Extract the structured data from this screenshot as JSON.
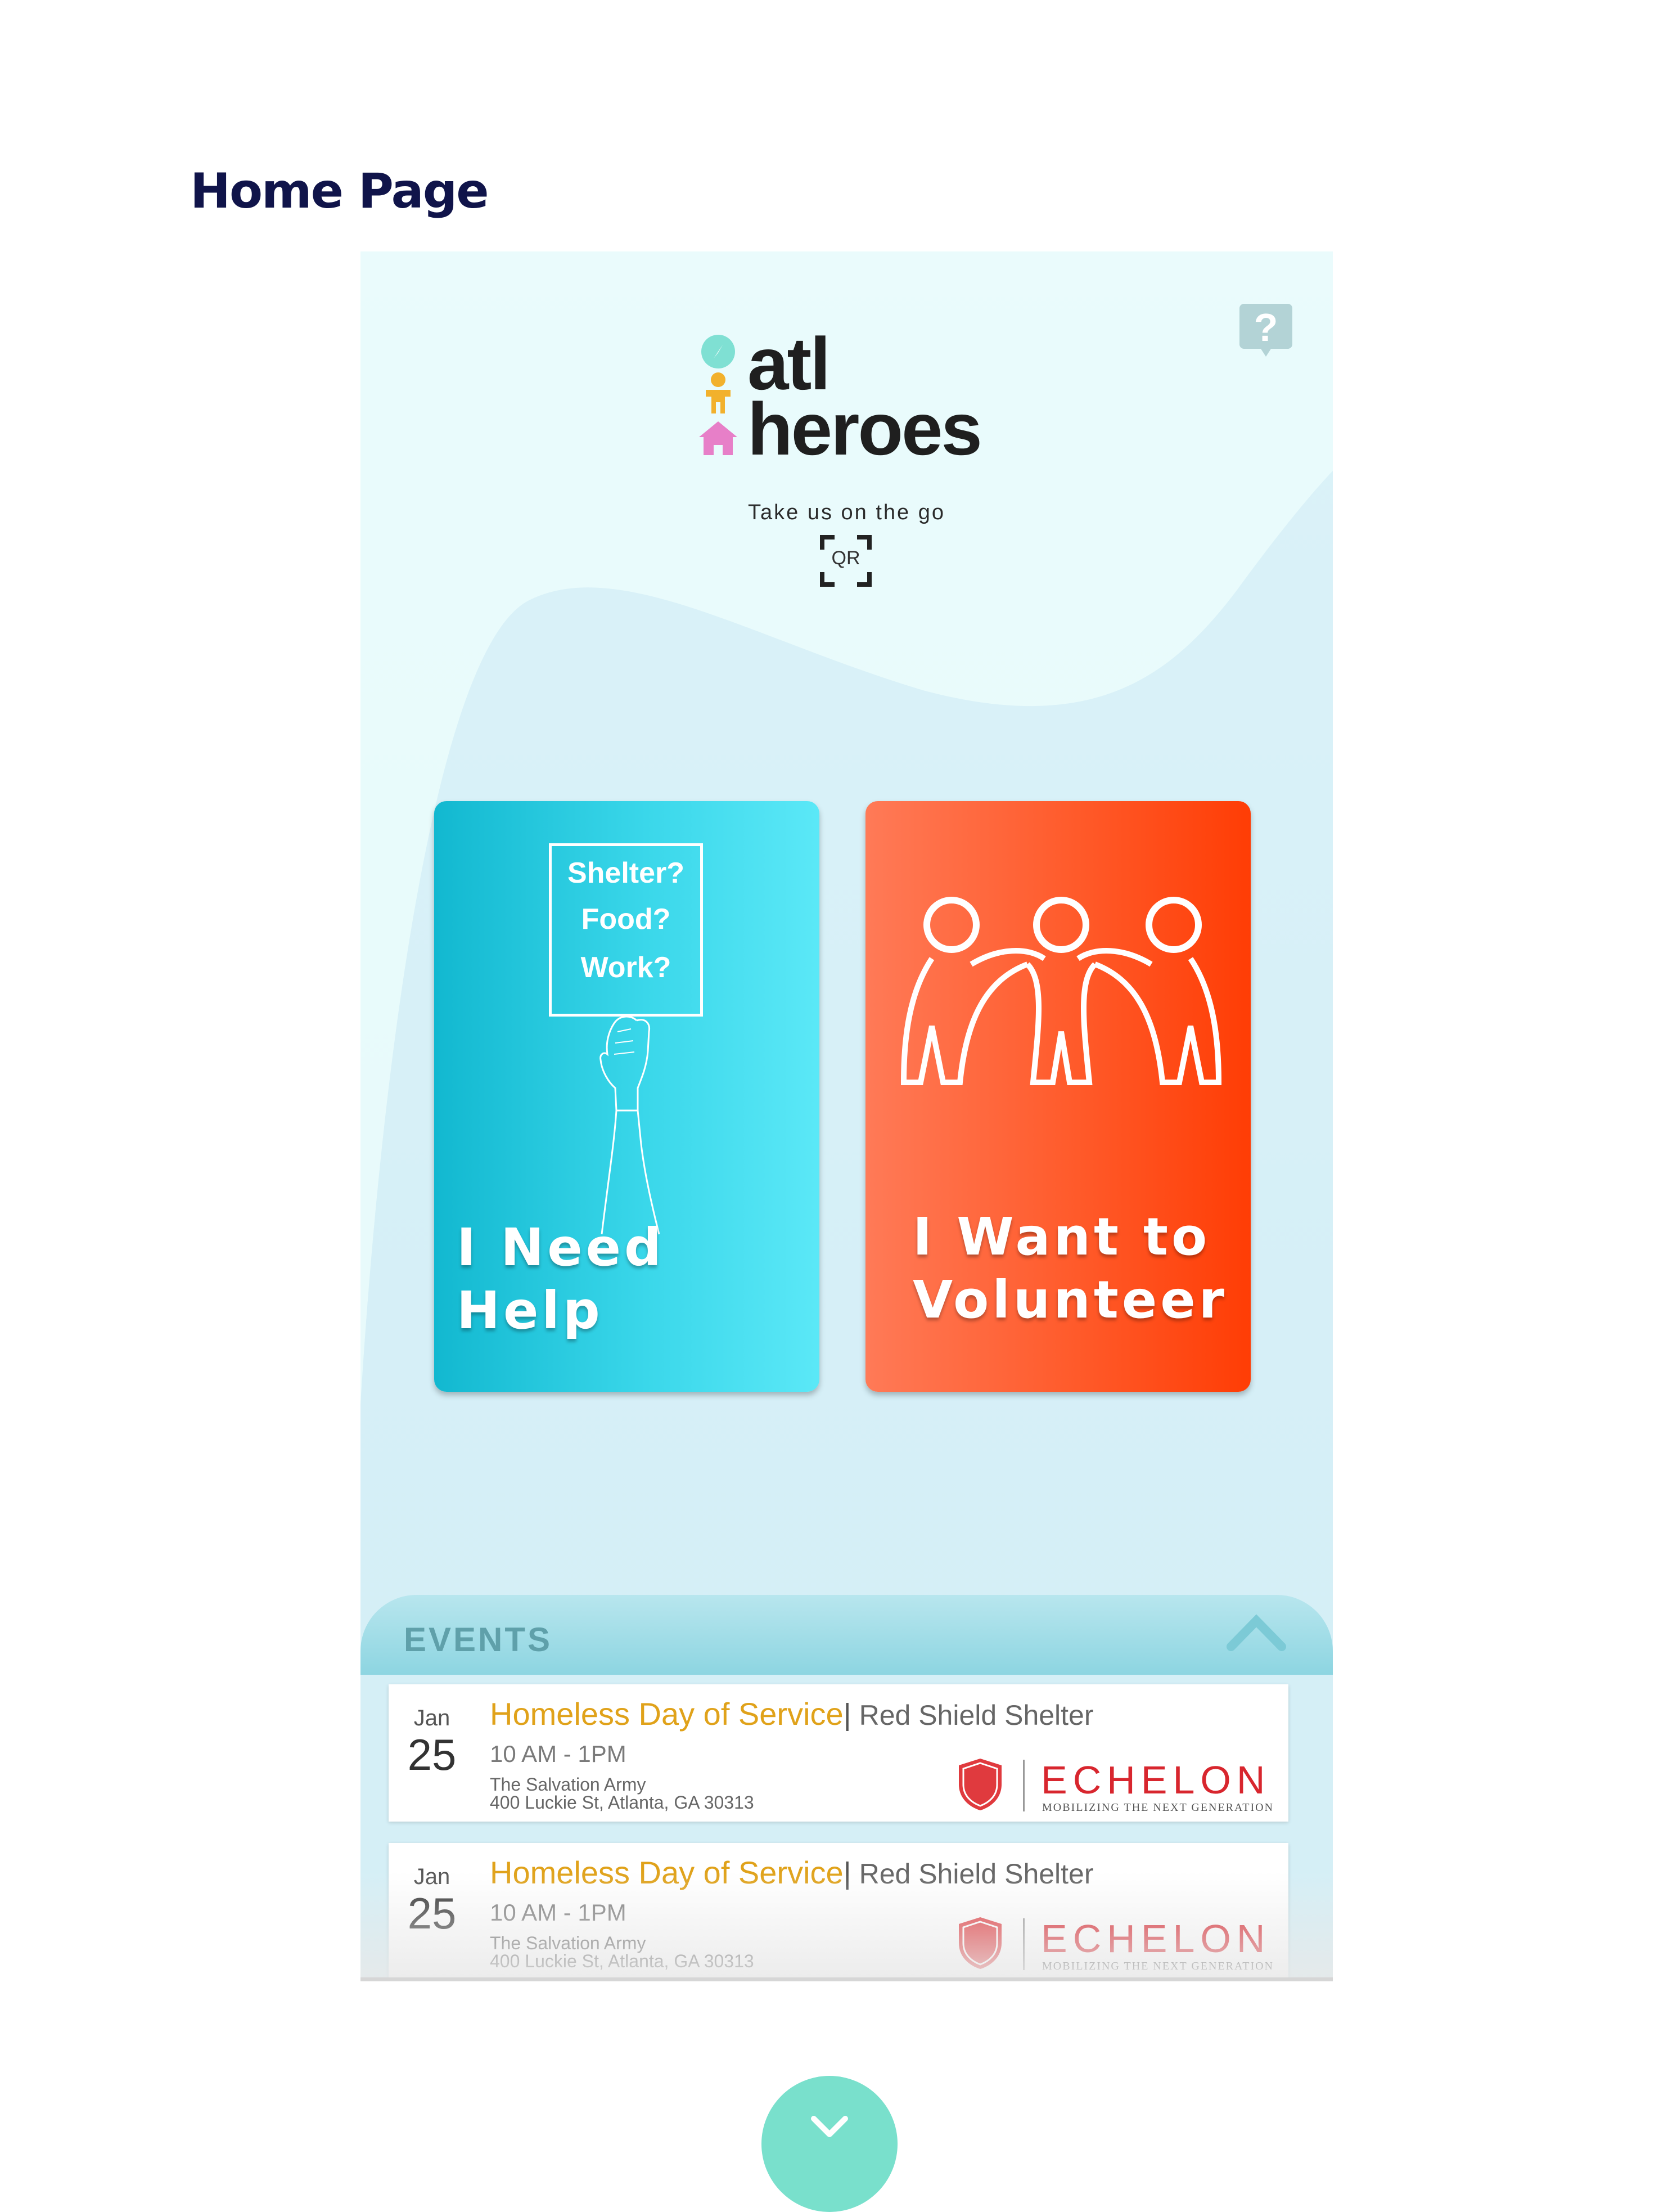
{
  "page": {
    "heading": "Home Page"
  },
  "app": {
    "logo_line1": "atl",
    "logo_line2": "heroes",
    "tagline": "Take us on the go",
    "qr_label": "QR",
    "help_icon": "question-bubble-icon"
  },
  "cards": {
    "help": {
      "sign_lines": [
        "Shelter?",
        "Food?",
        "Work?"
      ],
      "title": "I Need Help",
      "color_start": "#12b8d0",
      "color_end": "#5be8f7"
    },
    "volunteer": {
      "title_line1": "I Want to",
      "title_line2": "Volunteer",
      "color_start": "#ff7a57",
      "color_end": "#ff3d05"
    }
  },
  "events": {
    "header": "EVENTS",
    "items": [
      {
        "month": "Jan",
        "day": "25",
        "title": "Homeless Day of Service",
        "separator": "|",
        "venue": " Red Shield Shelter",
        "time": "10 AM - 1PM",
        "org": "The Salvation Army",
        "address": "400 Luckie St, Atlanta, GA 30313",
        "sponsor": "ECHELON",
        "sponsor_tagline": "MOBILIZING THE NEXT GENERATION"
      },
      {
        "month": "Jan",
        "day": "25",
        "title": "Homeless Day of Service",
        "separator": "|",
        "venue": " Red Shield Shelter",
        "time": "10 AM - 1PM",
        "org": "The Salvation Army",
        "address": "400 Luckie St, Atlanta, GA 30313",
        "sponsor": "ECHELON",
        "sponsor_tagline": "MOBILIZING THE NEXT GENERATION"
      }
    ]
  },
  "colors": {
    "heading": "#10144a",
    "event_title": "#e0a21a",
    "scroll_button": "#79e0cc"
  }
}
